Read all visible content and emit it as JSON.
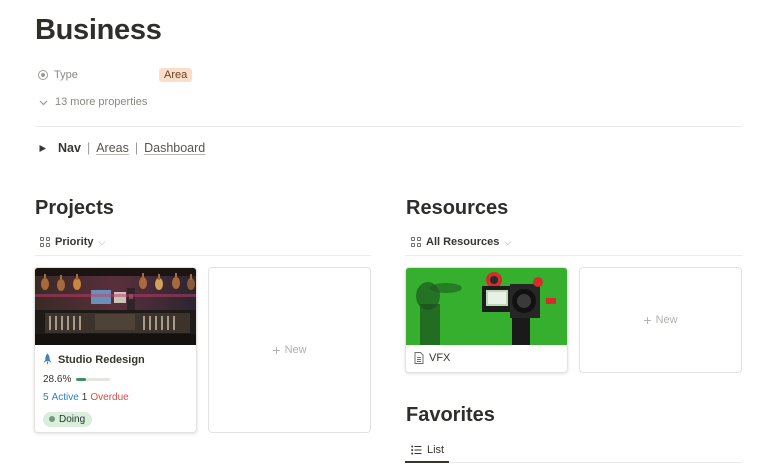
{
  "page": {
    "title": "Business"
  },
  "properties": {
    "type_label": "Type",
    "type_value": "Area",
    "more_label": "13 more properties"
  },
  "nav": {
    "toggle_label": "Nav",
    "separator": "|",
    "links": [
      "Areas",
      "Dashboard"
    ]
  },
  "projects": {
    "title": "Projects",
    "view_label": "Priority",
    "card": {
      "title": "Studio Redesign",
      "progress_text": "28.6%",
      "progress_value": 0.286,
      "active_count": "5",
      "active_label": "Active",
      "overdue_count": "1",
      "overdue_label": "Overdue",
      "status": "Doing"
    },
    "new_label": "New"
  },
  "resources": {
    "title": "Resources",
    "view_label": "All Resources",
    "card": {
      "title": "VFX"
    },
    "new_label": "New"
  },
  "favorites": {
    "title": "Favorites",
    "view_label": "List"
  },
  "colors": {
    "area_badge_bg": "#fadec9",
    "active_blue": "#2e7fc1",
    "overdue_red": "#d44c47",
    "progress_green": "#3f8f64",
    "status_bg": "#dbeddb"
  }
}
